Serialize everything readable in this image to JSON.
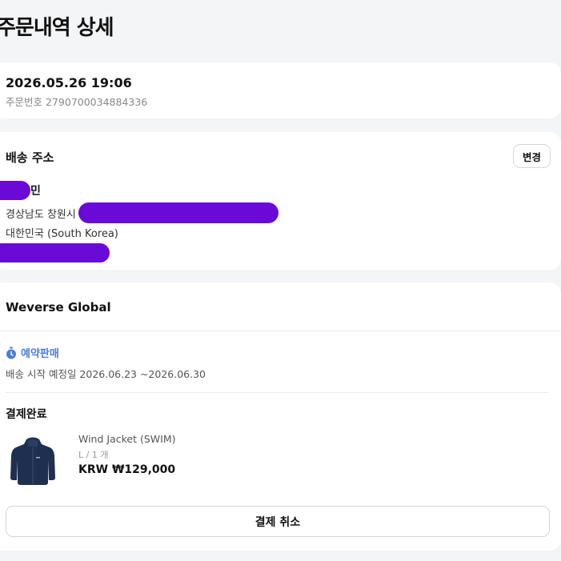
{
  "page": {
    "title": "주문내역 상세"
  },
  "order": {
    "datetime": "2026.05.26 19:06",
    "number_label": "주문번호",
    "number": "2790700034884336"
  },
  "shipping_address": {
    "title": "배송 주소",
    "change_label": "변경",
    "recipient_name_visible": "민",
    "address_line": "경상남도 창원시",
    "country_line": "대한민국 (South Korea)"
  },
  "seller": {
    "name": "Weverse Global",
    "preorder_badge": "예약판매",
    "ship_schedule": "배송 시작 예정일 2026.06.23 ~2026.06.30",
    "payment_status": "결제완료",
    "product": {
      "name": "Wind Jacket (SWIM)",
      "option": "L / 1 개",
      "price": "KRW ₩129,000"
    },
    "cancel_label": "결제 취소"
  },
  "colors": {
    "background": "#f4f5f7",
    "accent_blue": "#4a7ed9",
    "redaction": "#6a0ad6"
  }
}
